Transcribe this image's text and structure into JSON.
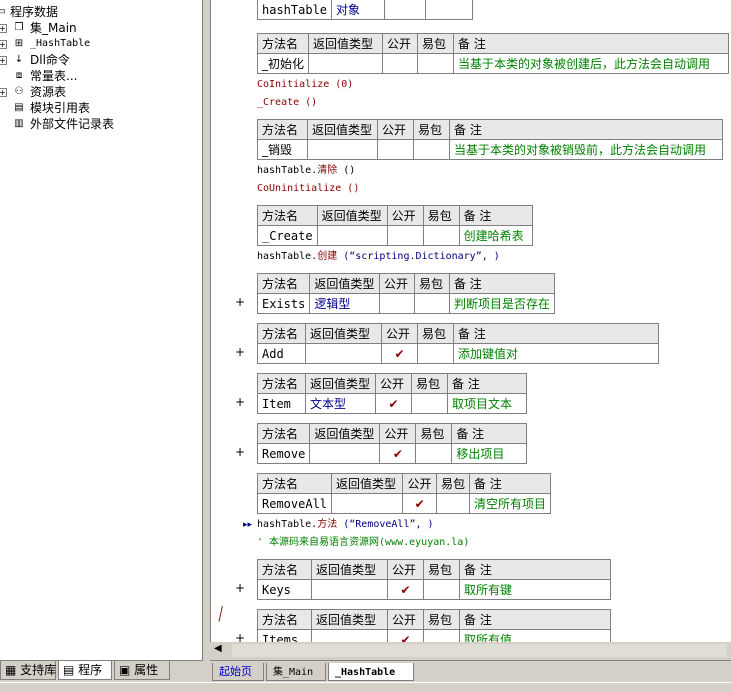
{
  "tree": {
    "root": "程序数据",
    "items": [
      "集_Main",
      "_HashTable",
      "Dll命令",
      "常量表...",
      "资源表",
      "模块引用表",
      "外部文件记录表"
    ]
  },
  "left_tabs": [
    "支持库",
    "程序",
    "属性"
  ],
  "columns": {
    "name": "方法名",
    "ret": "返回值类型",
    "pub": "公开",
    "easy": "易包",
    "note": "备 注"
  },
  "top_row": {
    "name": "hashTable",
    "type": "对象"
  },
  "methods": [
    {
      "name": "_初始化",
      "type": "",
      "pub": "",
      "note": "当基于本类的对象被创建后，此方法会自动调用"
    },
    {
      "name": "_销毁",
      "type": "",
      "pub": "",
      "note": "当基于本类的对象被销毁前，此方法会自动调用"
    },
    {
      "name": "_Create",
      "type": "",
      "pub": "",
      "note": "创建哈希表"
    },
    {
      "name": "Exists",
      "type": "逻辑型",
      "pub": "",
      "note": "判断项目是否存在"
    },
    {
      "name": "Add",
      "type": "",
      "pub": "✔",
      "note": "添加键值对"
    },
    {
      "name": "Item",
      "type": "文本型",
      "pub": "✔",
      "note": "取项目文本"
    },
    {
      "name": "Remove",
      "type": "",
      "pub": "✔",
      "note": "移出项目"
    },
    {
      "name": "RemoveAll",
      "type": "",
      "pub": "✔",
      "note": "清空所有项目"
    },
    {
      "name": "Keys",
      "type": "",
      "pub": "✔",
      "note": "取所有键"
    },
    {
      "name": "Items",
      "type": "",
      "pub": "✔",
      "note": "取所有值"
    }
  ],
  "code": {
    "c1": "CoInitialize (0)",
    "c2": "_Create ()",
    "c3a": "hashTable.",
    "c3b": "清除",
    "c3c": " ()",
    "c4": "CoUninitialize ()",
    "c5a": "hashTable.",
    "c5b": "创建",
    "c5c": " (“scripting.Dictionary”, )",
    "c6a": "hashTable.",
    "c6b": "方法",
    "c6c": " (“RemoveAll”, )",
    "c7": "' 本源码来自易语言资源网(www.eyuyan.la)"
  },
  "editor_tabs": [
    "起始页",
    "集_Main",
    "_HashTable"
  ],
  "colors": {
    "comment": "#008000",
    "keyword": "#8b0000",
    "type": "#00008b"
  }
}
